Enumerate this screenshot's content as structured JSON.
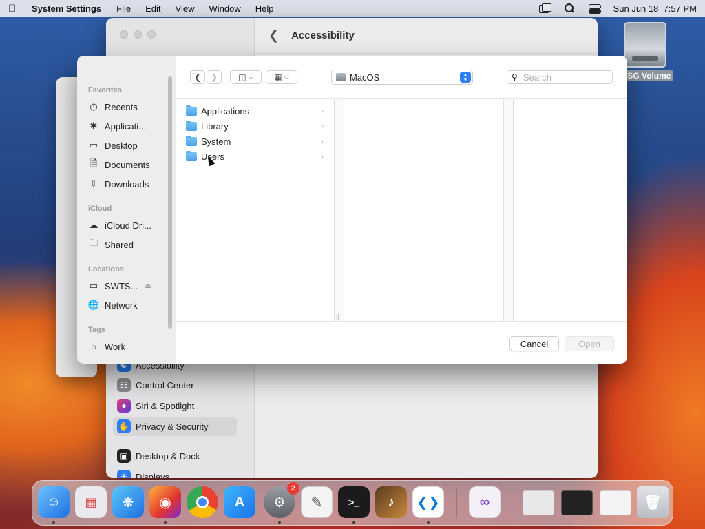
{
  "menubar": {
    "app_name": "System Settings",
    "menus": [
      "File",
      "Edit",
      "View",
      "Window",
      "Help"
    ],
    "datetime": "Sun Jun 18  7:57 PM"
  },
  "desktop": {
    "drive_label": "TSG Volume"
  },
  "settings_window": {
    "title": "Accessibility",
    "sidebar_items": [
      "Accessibility",
      "Control Center",
      "Siri & Spotlight",
      "Privacy & Security",
      "Desktop & Dock",
      "Displays"
    ],
    "selected": "Privacy & Security"
  },
  "dialog": {
    "sidebar": {
      "favorites_title": "Favorites",
      "favorites": [
        "Recents",
        "Applicati...",
        "Desktop",
        "Documents",
        "Downloads"
      ],
      "icloud_title": "iCloud",
      "icloud": [
        "iCloud Dri...",
        "Shared"
      ],
      "locations_title": "Locations",
      "locations": [
        "SWTS...",
        "Network"
      ],
      "tags_title": "Tags",
      "tags": [
        "Work"
      ]
    },
    "location": "MacOS",
    "search_placeholder": "Search",
    "folders": [
      "Applications",
      "Library",
      "System",
      "Users"
    ],
    "cancel_label": "Cancel",
    "open_label": "Open"
  },
  "dock": {
    "settings_badge": "2"
  }
}
